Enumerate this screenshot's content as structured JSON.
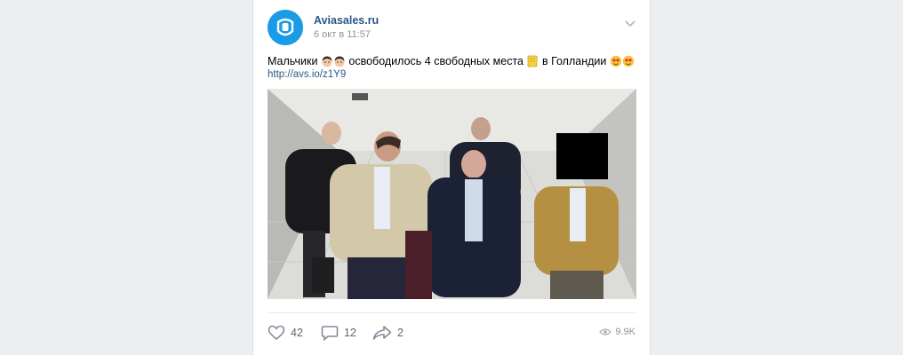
{
  "post": {
    "author": "Aviasales.ru",
    "date": "6 окт в 11:57",
    "text_part1": "Мальчики",
    "text_part2": "освободилось 4 свободных места",
    "text_part3": "в Голландии",
    "link": "http://avs.io/z1Y9"
  },
  "actions": {
    "likes": "42",
    "comments": "12",
    "shares": "2",
    "views": "9.9K"
  },
  "colors": {
    "brand": "#1a9be6",
    "link": "#2a5885",
    "background": "#edeef0"
  }
}
